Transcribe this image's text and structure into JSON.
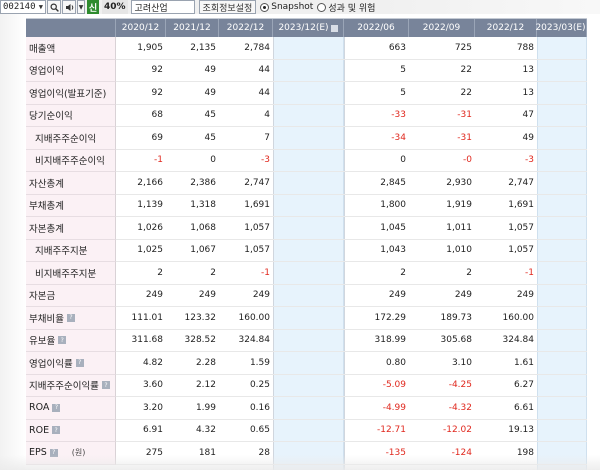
{
  "toolbar": {
    "code": "002140",
    "percent": "40%",
    "shin_label": "신",
    "company": "고려산업",
    "settings_label": "조회정보설정",
    "radio_snapshot": "Snapshot",
    "radio_risk": "성과 및 위험"
  },
  "columns": [
    "2020/12",
    "2021/12",
    "2022/12",
    "2023/12(E)",
    "2022/06",
    "2022/09",
    "2022/12",
    "2023/03(E)"
  ],
  "rows": [
    {
      "label": "매출액",
      "values": [
        "1,905",
        "2,135",
        "2,784",
        "",
        "663",
        "725",
        "788",
        ""
      ]
    },
    {
      "label": "영업이익",
      "values": [
        "92",
        "49",
        "44",
        "",
        "5",
        "22",
        "13",
        ""
      ]
    },
    {
      "label": "영업이익(발표기준)",
      "values": [
        "92",
        "49",
        "44",
        "",
        "5",
        "22",
        "13",
        ""
      ]
    },
    {
      "label": "당기순이익",
      "values": [
        "68",
        "45",
        "4",
        "",
        "-33",
        "-31",
        "47",
        ""
      ]
    },
    {
      "label": "지배주주순이익",
      "values": [
        "69",
        "45",
        "7",
        "",
        "-34",
        "-31",
        "49",
        ""
      ]
    },
    {
      "label": "비지배주주순이익",
      "values": [
        "-1",
        "0",
        "-3",
        "",
        "0",
        "-0",
        "-3",
        ""
      ]
    },
    {
      "label": "자산총계",
      "values": [
        "2,166",
        "2,386",
        "2,747",
        "",
        "2,845",
        "2,930",
        "2,747",
        ""
      ]
    },
    {
      "label": "부채총계",
      "values": [
        "1,139",
        "1,318",
        "1,691",
        "",
        "1,800",
        "1,919",
        "1,691",
        ""
      ]
    },
    {
      "label": "자본총계",
      "values": [
        "1,026",
        "1,068",
        "1,057",
        "",
        "1,045",
        "1,011",
        "1,057",
        ""
      ]
    },
    {
      "label": "지배주주지분",
      "values": [
        "1,025",
        "1,067",
        "1,057",
        "",
        "1,043",
        "1,010",
        "1,057",
        ""
      ]
    },
    {
      "label": "비지배주주지분",
      "values": [
        "2",
        "2",
        "-1",
        "",
        "2",
        "2",
        "-1",
        ""
      ]
    },
    {
      "label": "자본금",
      "values": [
        "249",
        "249",
        "249",
        "",
        "249",
        "249",
        "249",
        ""
      ]
    },
    {
      "label": "부채비율",
      "values": [
        "111.01",
        "123.32",
        "160.00",
        "",
        "172.29",
        "189.73",
        "160.00",
        ""
      ]
    },
    {
      "label": "유보율",
      "values": [
        "311.68",
        "328.52",
        "324.84",
        "",
        "318.99",
        "305.68",
        "324.84",
        ""
      ]
    },
    {
      "label": "영업이익률",
      "values": [
        "4.82",
        "2.28",
        "1.59",
        "",
        "0.80",
        "3.10",
        "1.61",
        ""
      ]
    },
    {
      "label": "지배주주순이익률",
      "values": [
        "3.60",
        "2.12",
        "0.25",
        "",
        "-5.09",
        "-4.25",
        "6.27",
        ""
      ]
    },
    {
      "label": "ROA",
      "values": [
        "3.20",
        "1.99",
        "0.16",
        "",
        "-4.99",
        "-4.32",
        "6.61",
        ""
      ]
    },
    {
      "label": "ROE",
      "values": [
        "6.91",
        "4.32",
        "0.65",
        "",
        "-12.71",
        "-12.02",
        "19.13",
        ""
      ]
    },
    {
      "label": "EPS",
      "unit": "(원)",
      "values": [
        "275",
        "181",
        "28",
        "",
        "-135",
        "-124",
        "198",
        ""
      ]
    }
  ],
  "help_icon_rows": [
    "부채비율",
    "유보율",
    "영업이익률",
    "지배주주순이익률",
    "ROA",
    "ROE",
    "EPS"
  ],
  "colors": {
    "header_bg": "#78849a",
    "label_bg": "#fbf1f5",
    "estimate_col_bg": "#e7f3fc",
    "negative": "#e0281e"
  }
}
